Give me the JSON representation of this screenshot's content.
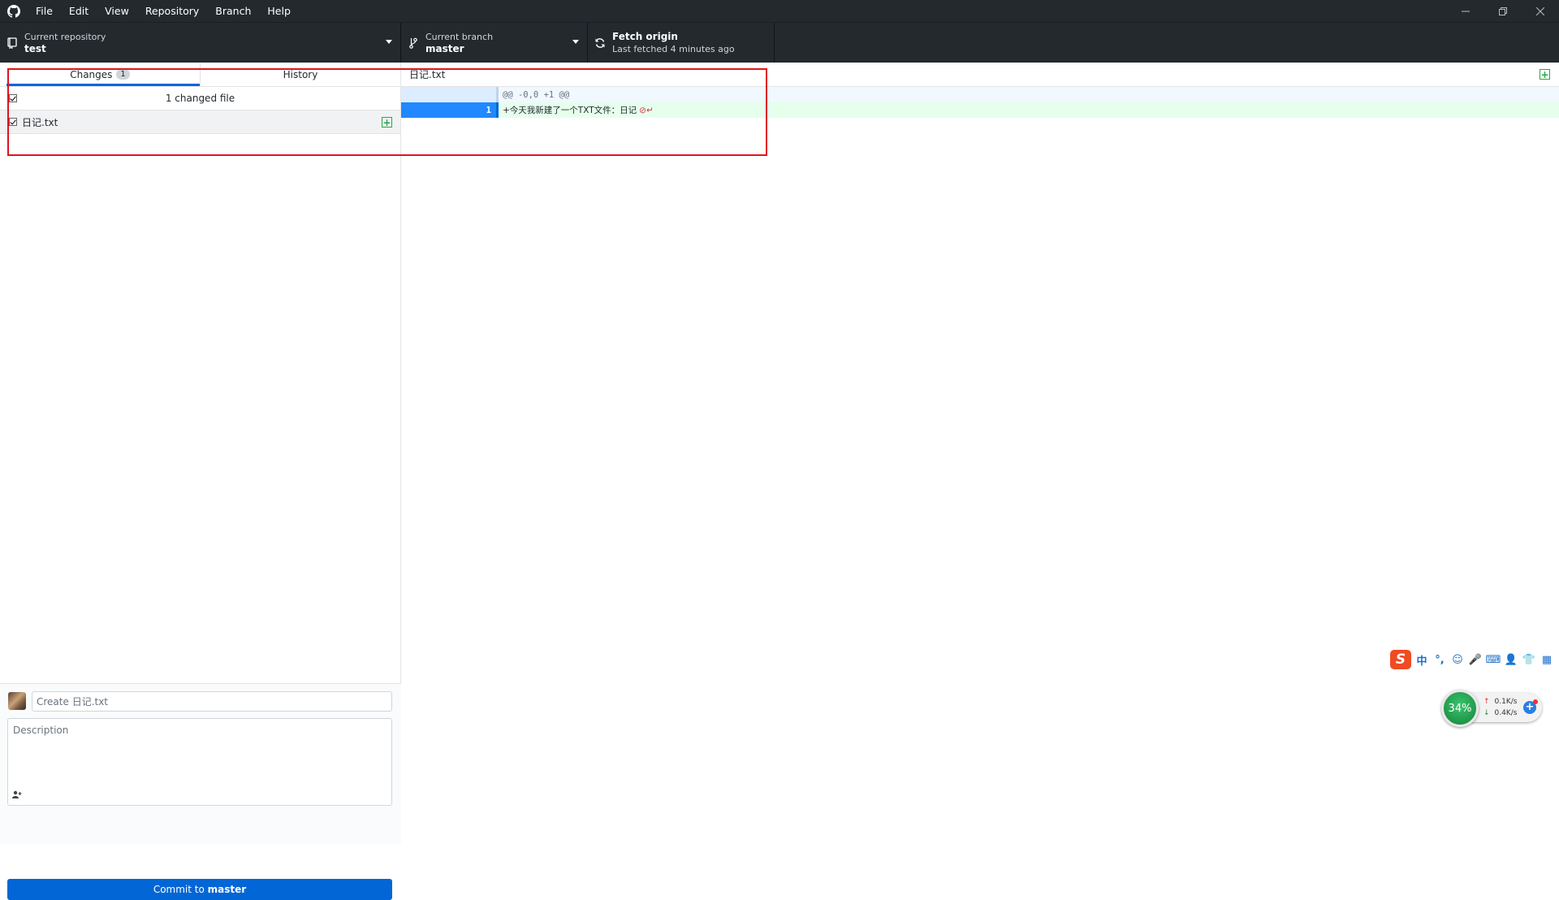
{
  "menu": [
    "File",
    "Edit",
    "View",
    "Repository",
    "Branch",
    "Help"
  ],
  "toolbar": {
    "repo_label": "Current repository",
    "repo_value": "test",
    "branch_label": "Current branch",
    "branch_value": "master",
    "fetch_label": "Fetch origin",
    "fetch_sub": "Last fetched 4 minutes ago"
  },
  "sidebar": {
    "tabs": [
      {
        "label": "Changes",
        "badge": "1"
      },
      {
        "label": "History"
      }
    ],
    "changes_count": "1 changed file",
    "files": [
      {
        "name": "日记.txt",
        "status": "added"
      }
    ]
  },
  "commit": {
    "summary_placeholder": "Create 日记.txt",
    "description_placeholder": "Description",
    "button_prefix": "Commit to ",
    "button_branch": "master"
  },
  "diff": {
    "file": "日记.txt",
    "hunk": "@@ -0,0 +1 @@",
    "lines": [
      {
        "new_num": "1",
        "text": "+今天我新建了一个TXT文件：日记"
      }
    ]
  },
  "ime": {
    "items": [
      "中",
      "°,",
      "☺",
      "🎤",
      "⌨",
      "👤",
      "👕",
      "▦"
    ]
  },
  "network": {
    "percent": "34%",
    "up": "0.1K/s",
    "down": "0.4K/s"
  },
  "colors": {
    "accent": "#0366d6",
    "added": "#28a745",
    "highlight": "#e0141e"
  }
}
